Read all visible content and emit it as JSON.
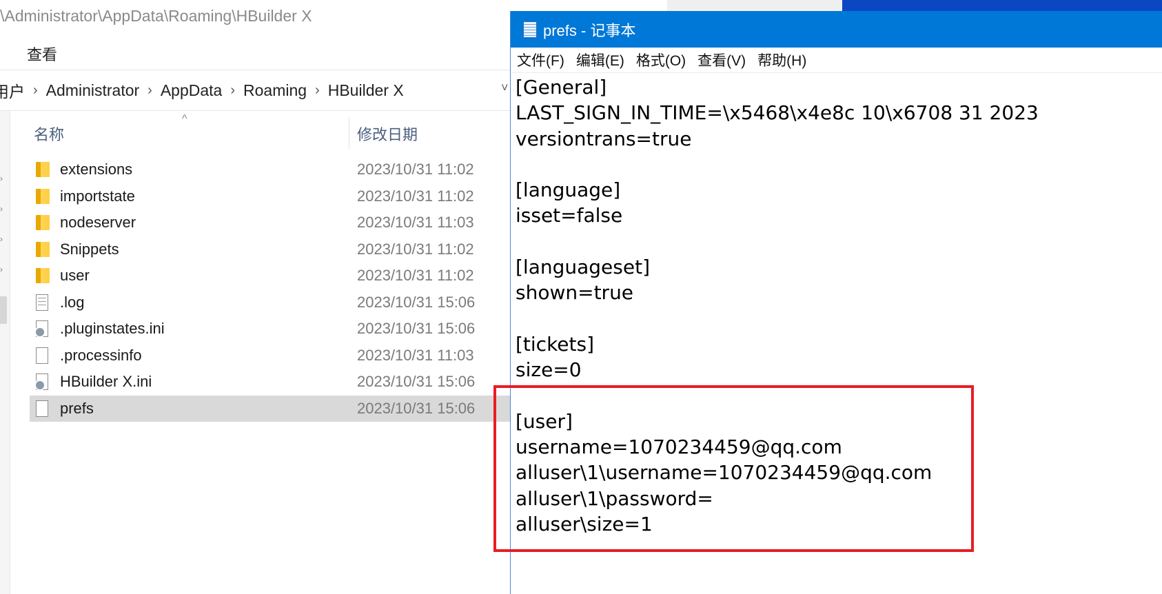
{
  "explorer": {
    "title_path": "\\Administrator\\AppData\\Roaming\\HBuilder X",
    "ribbon_tab": "查看",
    "breadcrumb": [
      "用户",
      "Administrator",
      "AppData",
      "Roaming",
      "HBuilder X"
    ],
    "breadcrumb_chevron": "›",
    "columns": {
      "name": "名称",
      "date": "修改日期"
    },
    "files": [
      {
        "name": "extensions",
        "date": "2023/10/31 11:02",
        "icon": "folder-icon"
      },
      {
        "name": "importstate",
        "date": "2023/10/31 11:02",
        "icon": "folder-icon"
      },
      {
        "name": "nodeserver",
        "date": "2023/10/31 11:03",
        "icon": "folder-icon"
      },
      {
        "name": "Snippets",
        "date": "2023/10/31 11:02",
        "icon": "folder-icon"
      },
      {
        "name": "user",
        "date": "2023/10/31 11:02",
        "icon": "folder-icon"
      },
      {
        "name": ".log",
        "date": "2023/10/31 15:06",
        "icon": "text-file-icon"
      },
      {
        "name": ".pluginstates.ini",
        "date": "2023/10/31 15:06",
        "icon": "ini-file-icon"
      },
      {
        "name": ".processinfo",
        "date": "2023/10/31 11:03",
        "icon": "blank-file-icon"
      },
      {
        "name": "HBuilder X.ini",
        "date": "2023/10/31 15:06",
        "icon": "ini-file-icon"
      },
      {
        "name": "prefs",
        "date": "2023/10/31 15:06",
        "icon": "blank-file-icon",
        "selected": true
      }
    ]
  },
  "notepad": {
    "title": "prefs - 记事本",
    "menu": [
      "文件(F)",
      "编辑(E)",
      "格式(O)",
      "查看(V)",
      "帮助(H)"
    ],
    "content_lines": [
      "[General]",
      "LAST_SIGN_IN_TIME=\\x5468\\x4e8c 10\\x6708 31 2023",
      "versiontrans=true",
      "",
      "[language]",
      "isset=false",
      "",
      "[languageset]",
      "shown=true",
      "",
      "[tickets]",
      "size=0",
      "",
      "[user]",
      "username=1070234459@qq.com",
      "alluser\\1\\username=1070234459@qq.com",
      "alluser\\1\\password=",
      "alluser\\size=1"
    ]
  },
  "colors": {
    "notepad_titlebar": "#0078d7",
    "highlight_border": "#ea1c24",
    "selected_row": "#d9d9d9"
  }
}
